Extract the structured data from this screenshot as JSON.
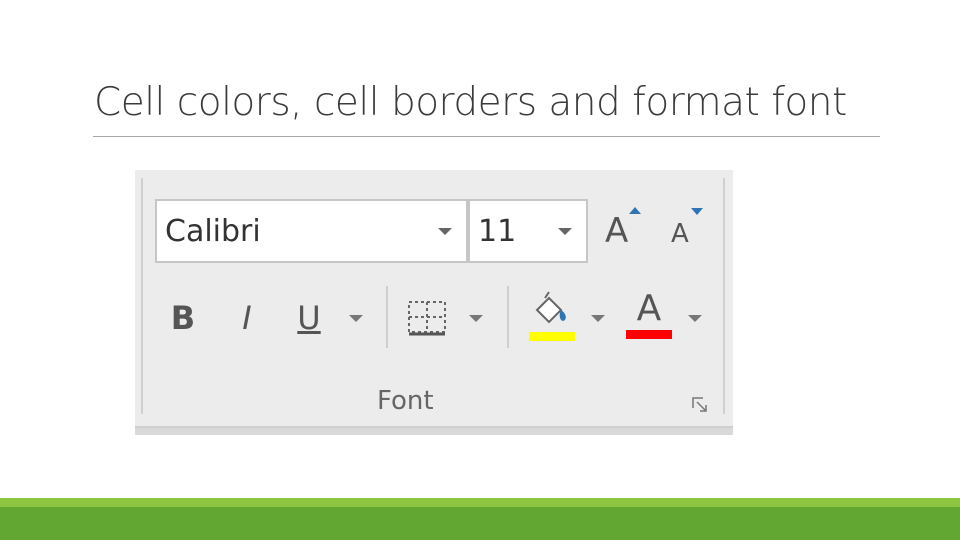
{
  "slide": {
    "title": "Cell colors, cell borders and format font"
  },
  "ribbon": {
    "font_name": "Calibri",
    "font_size": "11",
    "grow_glyph": "A",
    "shrink_glyph": "A",
    "bold_glyph": "B",
    "italic_glyph": "I",
    "underline_glyph": "U",
    "font_color_glyph": "A",
    "group_label": "Font",
    "icons": [
      "chevron-down-icon",
      "increase-font-size-icon",
      "decrease-font-size-icon",
      "bold-icon",
      "italic-icon",
      "underline-icon",
      "borders-icon",
      "fill-color-icon",
      "font-color-icon",
      "dialog-launcher-icon"
    ]
  },
  "colors": {
    "fill_color": "#ffff00",
    "font_color": "#ff0000",
    "grow_shrink_arrows": "#2e75b6",
    "footer_band_light": "#8dc540",
    "footer_band_dark": "#63a733"
  }
}
